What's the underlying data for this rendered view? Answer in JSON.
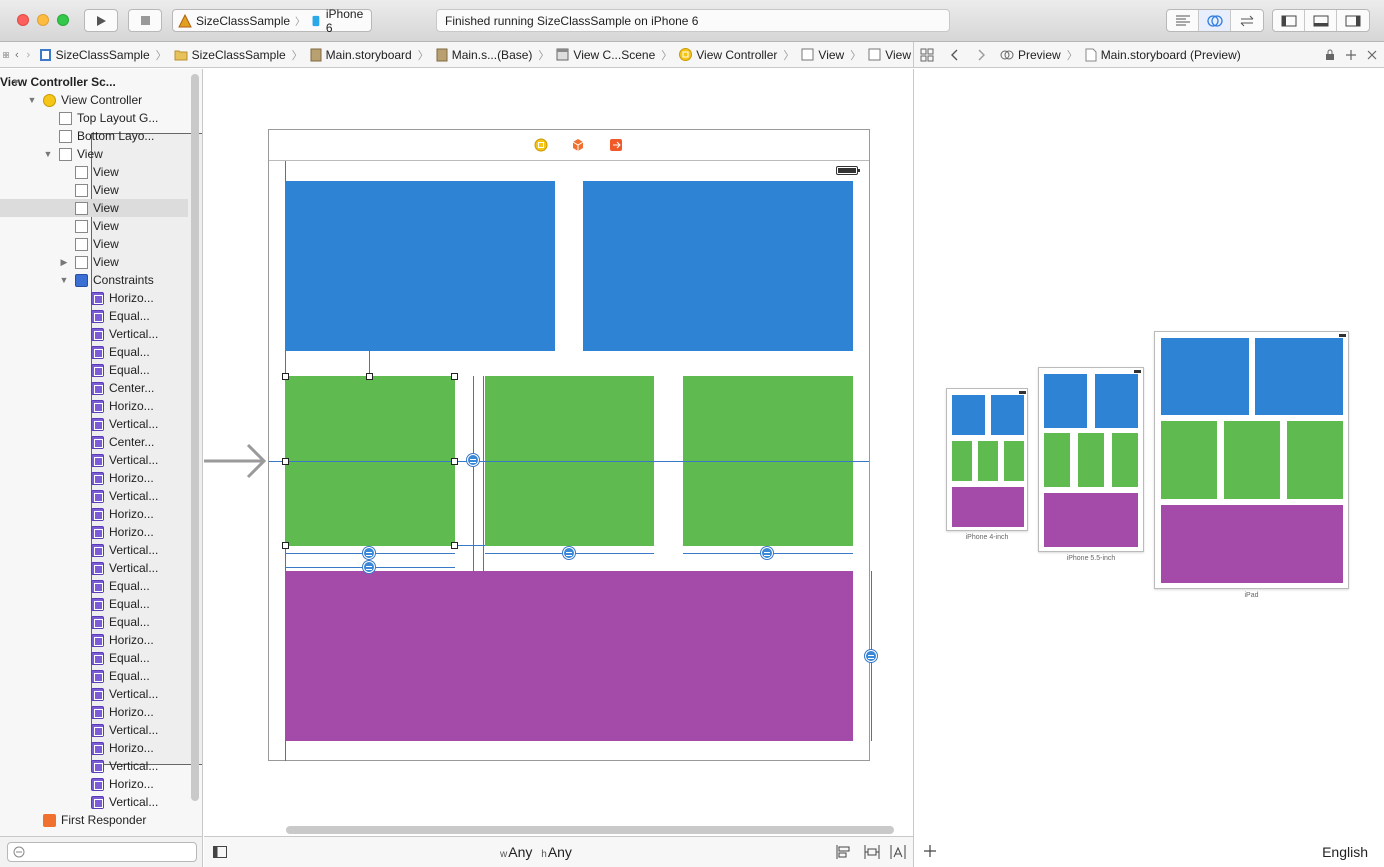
{
  "toolbar": {
    "scheme_app": "SizeClassSample",
    "scheme_device": "iPhone 6",
    "status": "Finished running SizeClassSample on iPhone 6"
  },
  "jumpbar": {
    "items": [
      "SizeClassSample",
      "SizeClassSample",
      "Main.storyboard",
      "Main.s...(Base)",
      "View C...Scene",
      "View Controller",
      "View",
      "View"
    ]
  },
  "assistant": {
    "mode": "Preview",
    "file": "Main.storyboard (Preview)"
  },
  "outline": {
    "rows": [
      {
        "label": "View Controller Sc...",
        "icon": "scene-icon",
        "bold": true,
        "disc": "▼"
      },
      {
        "label": "View Controller",
        "icon": "view-controller-icon",
        "disc": "▼"
      },
      {
        "label": "Top Layout G...",
        "icon": "layout-guide-icon"
      },
      {
        "label": "Bottom Layo...",
        "icon": "layout-guide-icon"
      },
      {
        "label": "View",
        "icon": "view-icon",
        "disc": "▼"
      },
      {
        "label": "View",
        "icon": "view-icon"
      },
      {
        "label": "View",
        "icon": "view-icon"
      },
      {
        "label": "View",
        "icon": "view-icon",
        "selected": true
      },
      {
        "label": "View",
        "icon": "view-icon"
      },
      {
        "label": "View",
        "icon": "view-icon"
      },
      {
        "label": "View",
        "icon": "view-icon",
        "disc": "▶"
      },
      {
        "label": "Constraints",
        "icon": "constraints-group-icon",
        "disc": "▼"
      },
      {
        "label": "Horizo...",
        "icon": "constraint-icon"
      },
      {
        "label": "Equal...",
        "icon": "constraint-icon"
      },
      {
        "label": "Vertical...",
        "icon": "constraint-icon"
      },
      {
        "label": "Equal...",
        "icon": "constraint-icon"
      },
      {
        "label": "Equal...",
        "icon": "constraint-icon"
      },
      {
        "label": "Center...",
        "icon": "constraint-icon"
      },
      {
        "label": "Horizo...",
        "icon": "constraint-icon"
      },
      {
        "label": "Vertical...",
        "icon": "constraint-icon"
      },
      {
        "label": "Center...",
        "icon": "constraint-icon"
      },
      {
        "label": "Vertical...",
        "icon": "constraint-icon"
      },
      {
        "label": "Horizo...",
        "icon": "constraint-icon"
      },
      {
        "label": "Vertical...",
        "icon": "constraint-icon"
      },
      {
        "label": "Horizo...",
        "icon": "constraint-icon"
      },
      {
        "label": "Horizo...",
        "icon": "constraint-icon"
      },
      {
        "label": "Vertical...",
        "icon": "constraint-icon"
      },
      {
        "label": "Vertical...",
        "icon": "constraint-icon"
      },
      {
        "label": "Equal...",
        "icon": "constraint-icon"
      },
      {
        "label": "Equal...",
        "icon": "constraint-icon"
      },
      {
        "label": "Equal...",
        "icon": "constraint-icon"
      },
      {
        "label": "Horizo...",
        "icon": "constraint-icon"
      },
      {
        "label": "Equal...",
        "icon": "constraint-icon"
      },
      {
        "label": "Equal...",
        "icon": "constraint-icon"
      },
      {
        "label": "Vertical...",
        "icon": "constraint-icon"
      },
      {
        "label": "Horizo...",
        "icon": "constraint-icon"
      },
      {
        "label": "Vertical...",
        "icon": "constraint-icon"
      },
      {
        "label": "Horizo...",
        "icon": "constraint-icon"
      },
      {
        "label": "Vertical...",
        "icon": "constraint-icon"
      },
      {
        "label": "Horizo...",
        "icon": "constraint-icon"
      },
      {
        "label": "Vertical...",
        "icon": "constraint-icon"
      },
      {
        "label": "First Responder",
        "icon": "first-responder-icon"
      }
    ]
  },
  "sizeclass": {
    "w_prefix": "w",
    "w_value": "Any",
    "h_prefix": "h",
    "h_value": "Any"
  },
  "preview": {
    "devices": [
      {
        "label": "iPhone 4-inch"
      },
      {
        "label": "iPhone 5.5-inch"
      },
      {
        "label": "iPad"
      }
    ],
    "language": "English"
  },
  "colors": {
    "blue": "#2e83d4",
    "green": "#5fba4f",
    "purple": "#a44aa9",
    "constraint": "#3a78c8"
  }
}
